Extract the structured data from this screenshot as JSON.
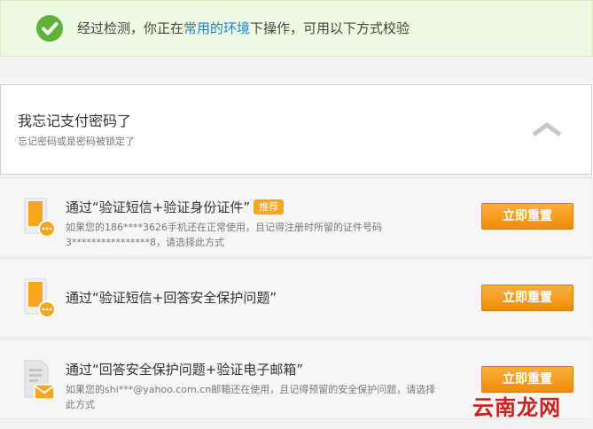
{
  "banner": {
    "msg_pre": "经过检测，你正在",
    "msg_hl": "常用的环境",
    "msg_post": "下操作，可用以下方式校验",
    "icon": "check-circle-icon"
  },
  "forgot": {
    "title": "我忘记支付密码了",
    "subtitle": "忘记密码或是密码被锁定了",
    "icon": "chevron-up-icon"
  },
  "options": [
    {
      "name": "通过“验证短信+验证身份证件”",
      "badge": "推荐",
      "desc": "如果您的186****3626手机还在正常使用，且记得注册时所留的证件号码3****************8，请选择此方式",
      "button": "立即重置",
      "icon": "phone-sms-icon"
    },
    {
      "name": "通过“验证短信+回答安全保护问题”",
      "desc": "",
      "button": "立即重置",
      "icon": "phone-sms-icon"
    },
    {
      "name": "通过“回答安全保护问题+验证电子邮箱”",
      "desc": "如果您的shi***@yahoo.com.cn邮箱还在使用，且记得预留的安全保护问题，请选择此方式",
      "button": "立即重置",
      "icon": "document-mail-icon"
    }
  ],
  "watermark": "云南龙网",
  "colors": {
    "accent": "#1a82d4",
    "button": "#f5a623",
    "success": "#5db33a",
    "watermark": "#cc1f1f"
  }
}
